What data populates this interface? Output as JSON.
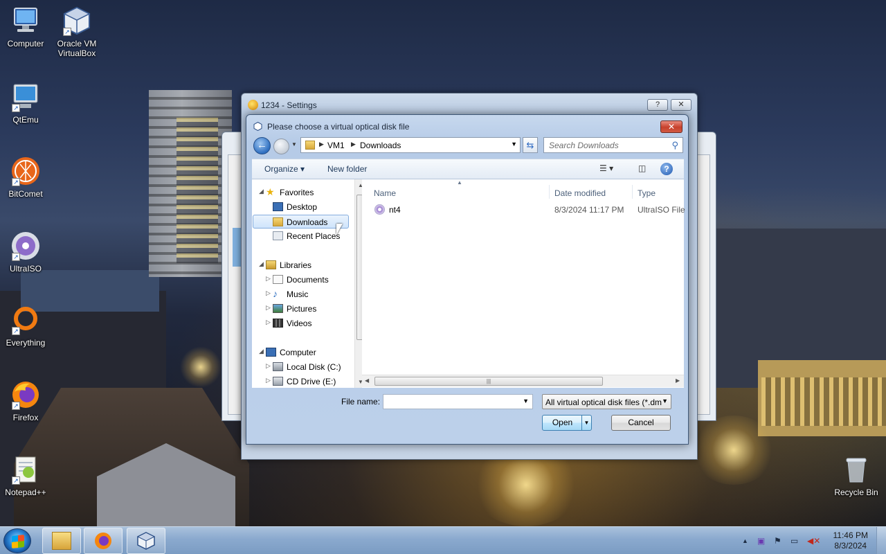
{
  "desktop": {
    "icons": [
      {
        "label": "Computer",
        "icon": "computer-icon"
      },
      {
        "label": "Oracle VM VirtualBox",
        "icon": "virtualbox-icon"
      },
      {
        "label": "QtEmu",
        "icon": "qtemu-icon"
      },
      {
        "label": "BitComet",
        "icon": "bitcomet-icon"
      },
      {
        "label": "UltraISO",
        "icon": "ultraiso-icon"
      },
      {
        "label": "Everything",
        "icon": "everything-icon"
      },
      {
        "label": "Firefox",
        "icon": "firefox-icon"
      },
      {
        "label": "Notepad++",
        "icon": "notepadpp-icon"
      },
      {
        "label": "Recycle Bin",
        "icon": "recycle-bin-icon"
      }
    ]
  },
  "settings_window": {
    "title": "1234 - Settings",
    "help_glyph": "?",
    "close_glyph": "✕"
  },
  "dialog": {
    "title": "Please choose a virtual optical disk file",
    "close_glyph": "✕",
    "address": {
      "segments": [
        "VM1",
        "Downloads"
      ]
    },
    "search": {
      "placeholder": "Search Downloads"
    },
    "toolbar": {
      "organize": "Organize",
      "new_folder": "New folder",
      "help": "?"
    },
    "nav": {
      "favorites": "Favorites",
      "desktop": "Desktop",
      "downloads": "Downloads",
      "recent": "Recent Places",
      "libraries": "Libraries",
      "documents": "Documents",
      "music": "Music",
      "pictures": "Pictures",
      "videos": "Videos",
      "computer": "Computer",
      "local_disk": "Local Disk (C:)",
      "cd_drive": "CD Drive (E:)"
    },
    "columns": {
      "name": "Name",
      "date": "Date modified",
      "type": "Type"
    },
    "files": [
      {
        "name": "nt4",
        "date": "8/3/2024 11:17 PM",
        "type": "UltraISO File"
      }
    ],
    "file_name_label": "File name:",
    "file_name_value": "",
    "filter_value": "All virtual optical disk files (*.dm",
    "open_label": "Open",
    "cancel_label": "Cancel"
  },
  "taskbar": {
    "time": "11:46 PM",
    "date": "8/3/2024"
  }
}
